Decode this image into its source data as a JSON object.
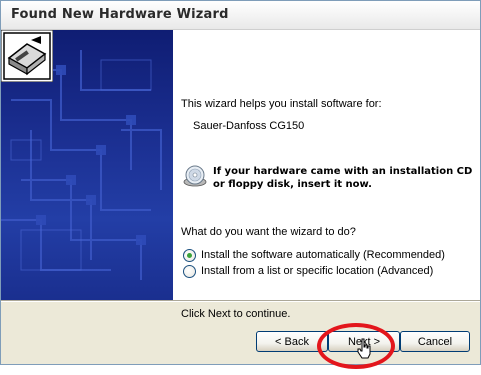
{
  "window": {
    "title": "Found New Hardware Wizard"
  },
  "content": {
    "intro": "This wizard helps you install software for:",
    "device_name": "Sauer-Danfoss CG150",
    "cd_line1": "If your hardware came with an installation CD",
    "cd_line2": "or floppy disk, insert it now.",
    "question": "What do you want the wizard to do?",
    "options": [
      {
        "label": "Install the software automatically (Recommended)",
        "selected": true
      },
      {
        "label": "Install from a list or specific location (Advanced)",
        "selected": false
      }
    ],
    "continue_hint": "Click Next to continue."
  },
  "buttons": {
    "back": "< Back",
    "next": "Next >",
    "cancel": "Cancel"
  },
  "icons": {
    "hardware": "hardware-install-icon",
    "cd": "cd-disc-icon",
    "cursor": "mouse-pointer-icon"
  },
  "colors": {
    "highlight_ring": "#e3161c",
    "side_panel": "#1b2f91",
    "radio_selected": "#3aa23a"
  }
}
